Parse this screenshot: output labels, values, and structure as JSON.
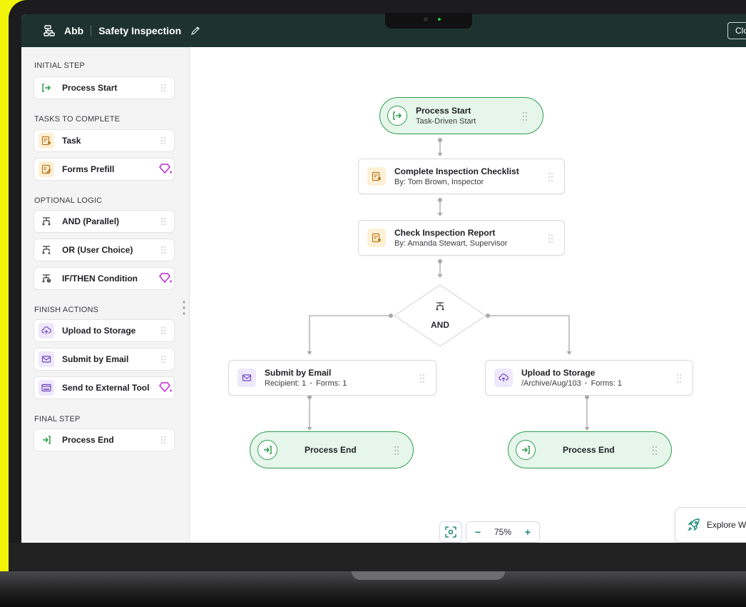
{
  "header": {
    "org": "Abb",
    "title": "Safety Inspection",
    "close_label": "Clo"
  },
  "sidebar": {
    "sections": [
      {
        "label": "INITIAL STEP"
      },
      {
        "label": "TASKS TO COMPLETE"
      },
      {
        "label": "OPTIONAL LOGIC"
      },
      {
        "label": "FINISH ACTIONS"
      },
      {
        "label": "FINAL STEP"
      }
    ],
    "items": [
      {
        "label": "Process Start",
        "icon": "enter-icon",
        "premium": false
      },
      {
        "label": "Task",
        "icon": "task-icon",
        "premium": false
      },
      {
        "label": "Forms Prefill",
        "icon": "form-edit-icon",
        "premium": true
      },
      {
        "label": "AND (Parallel)",
        "icon": "parallel-icon",
        "premium": false
      },
      {
        "label": "OR (User Choice)",
        "icon": "choice-icon",
        "premium": false
      },
      {
        "label": "IF/THEN Condition",
        "icon": "condition-icon",
        "premium": true
      },
      {
        "label": "Upload to Storage",
        "icon": "cloud-upload-icon",
        "premium": false
      },
      {
        "label": "Submit by Email",
        "icon": "mail-icon",
        "premium": false
      },
      {
        "label": "Send to External Tool",
        "icon": "http-icon",
        "premium": true
      },
      {
        "label": "Process End",
        "icon": "exit-icon",
        "premium": false
      }
    ]
  },
  "flow": {
    "start": {
      "title": "Process Start",
      "subtitle": "Task-Driven Start"
    },
    "task1": {
      "title": "Complete Inspection Checklist",
      "subtitle": "By: Tom Brown, Inspector"
    },
    "task2": {
      "title": "Check Inspection Report",
      "subtitle": "By: Amanda Stewart, Supervisor"
    },
    "gateway": {
      "label": "AND"
    },
    "email": {
      "title": "Submit by Email",
      "subtitle_a": "Recipient: 1",
      "subtitle_b": "Forms: 1"
    },
    "storage": {
      "title": "Upload to Storage",
      "subtitle_a": "/Archive/Aug/103",
      "subtitle_b": "Forms: 1"
    },
    "end_left": {
      "label": "Process End"
    },
    "end_right": {
      "label": "Process End"
    }
  },
  "zoom": {
    "minus": "−",
    "value": "75%",
    "plus": "+"
  },
  "explore": {
    "label": "Explore Workflo"
  },
  "colors": {
    "topbar": "#1e3330",
    "accent_green": "#2e9e4f",
    "pill_fill": "#e6f6ea",
    "teal": "#1a8a7a",
    "task_icon_bg": "#fdf0d5",
    "finish_icon_bg": "#efe7fb",
    "premium": "#c026d3",
    "backdrop": "#f2f50a"
  }
}
